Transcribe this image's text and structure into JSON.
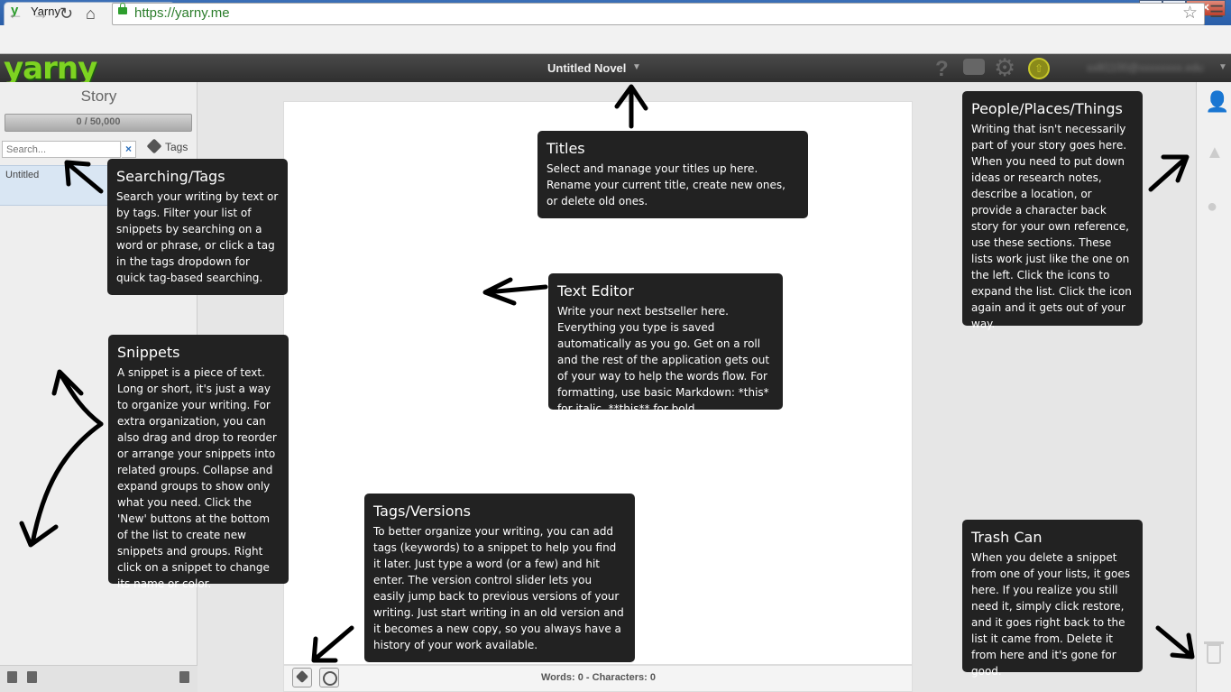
{
  "browser": {
    "tab_title": "Yarny",
    "tab_favicon": "y",
    "tab_close": "×",
    "url": "https://yarny.me",
    "window_buttons": [
      "–",
      "□",
      "✕"
    ]
  },
  "app": {
    "logo": "yarny",
    "novel_title": "Untitled Novel",
    "novel_caret": "▼",
    "user_email": "xxlll1100@xxxxxxxx.edu",
    "user_caret": "▼",
    "header_icons": [
      "help-icon",
      "chat-icon",
      "gear-icon",
      "upload-icon"
    ]
  },
  "left_panel": {
    "title": "Story",
    "word_goal": "0 / 50,000",
    "search_placeholder": "Search...",
    "search_clear": "×",
    "tags_label": "Tags",
    "snippets": [
      {
        "label": "Untitled"
      }
    ]
  },
  "editor": {
    "stats": "Words: 0 - Characters: 0"
  },
  "tooltips": {
    "search": {
      "title": "Searching/Tags",
      "body": "Search your writing by text or by tags. Filter your list of snippets by searching on a word or phrase, or click a tag in the tags dropdown for quick tag-based searching."
    },
    "titles": {
      "title": "Titles",
      "body": "Select and manage your titles up here. Rename your current title, create new ones, or delete old ones."
    },
    "editor": {
      "title": "Text Editor",
      "body": "Write your next bestseller here. Everything you type is saved automatically as you go. Get on a roll and the rest of the application gets out of your way to help the words flow. For formatting, use basic Markdown: *this* for italic, **this** for bold."
    },
    "ppt": {
      "title": "People/Places/Things",
      "body": "Writing that isn't necessarily part of your story goes here. When you need to put down ideas or research notes, describe a location, or provide a character back story for your own reference, use these sections. These lists work just like the one on the left. Click the icons to expand the list. Click the icon again and it gets out of your way."
    },
    "snippets": {
      "title": "Snippets",
      "body": "A snippet is a piece of text. Long or short, it's just a way to organize your writing. For extra organization, you can also drag and drop to reorder or arrange your snippets into related groups. Collapse and expand groups to show only what you need. Click the 'New' buttons at the bottom of the list to create new snippets and groups. Right click on a snippet to change its name or color."
    },
    "tags": {
      "title": "Tags/Versions",
      "body": "To better organize your writing, you can add tags (keywords) to a snippet to help you find it later. Just type a word (or a few) and hit enter. The version control slider lets you easily jump back to previous versions of your writing. Just start writing in an old version and it becomes a new copy, so you always have a history of your work available."
    },
    "trash": {
      "title": "Trash Can",
      "body": "When you delete a snippet from one of your lists, it goes here. If you realize you still need it, simply click restore, and it goes right back to the list it came from. Delete it from here and it's gone for good."
    }
  }
}
